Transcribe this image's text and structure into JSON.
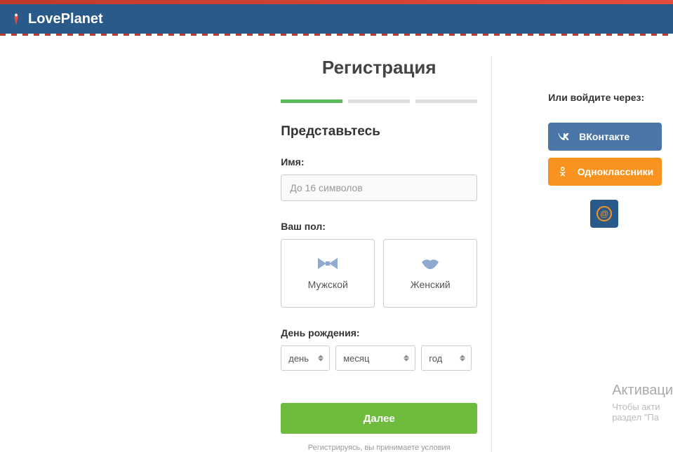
{
  "header": {
    "brand": "LovePlanet"
  },
  "registration": {
    "title": "Регистрация",
    "subtitle": "Представьтесь",
    "name_label": "Имя:",
    "name_placeholder": "До 16 символов",
    "gender_label": "Ваш пол:",
    "gender_male": "Мужской",
    "gender_female": "Женский",
    "dob_label": "День рождения:",
    "day_placeholder": "день",
    "month_placeholder": "месяц",
    "year_placeholder": "год",
    "next_button": "Далее",
    "terms_text": "Регистрируясь, вы принимаете условия"
  },
  "sidebar": {
    "login_via": "Или войдите через:",
    "vk_label": "ВКонтакте",
    "ok_label": "Одноклассники"
  },
  "watermark": {
    "title": "Активаци",
    "line1": "Чтобы акти",
    "line2": "раздел \"Па"
  }
}
